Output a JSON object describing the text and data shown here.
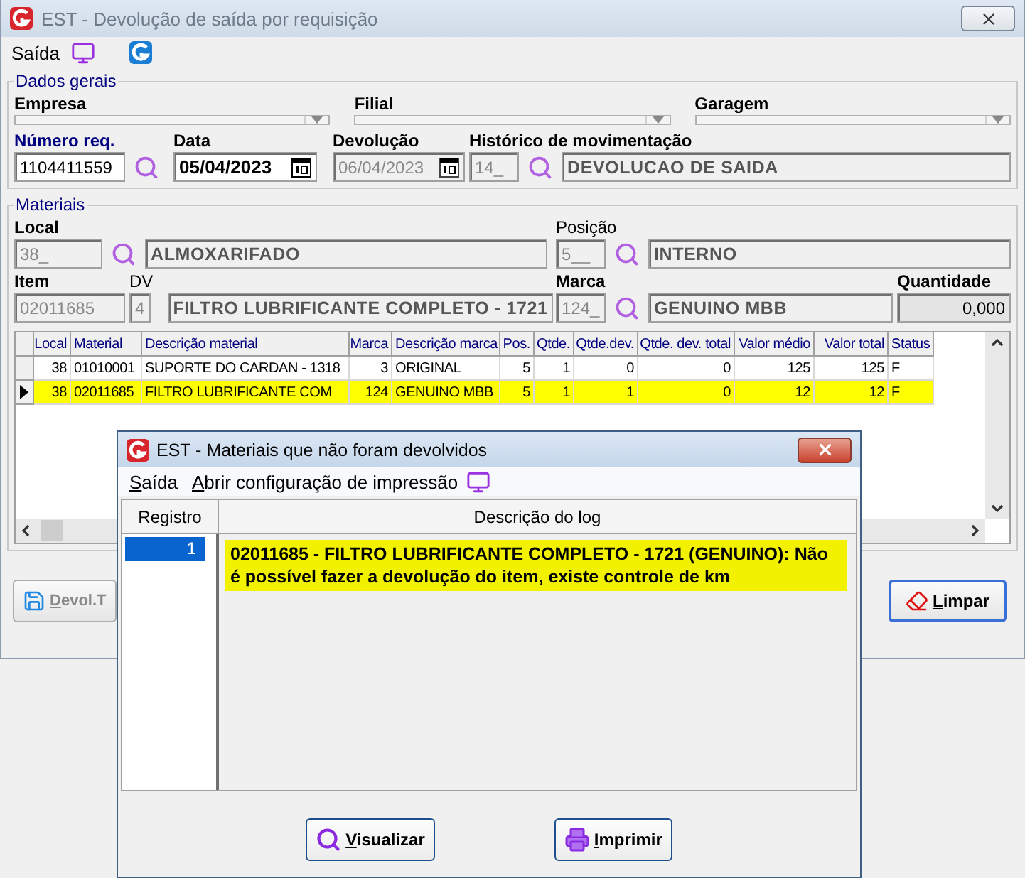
{
  "window": {
    "title": "EST -  Devolução de saída por requisição"
  },
  "toolbar": {
    "menu": "Saída"
  },
  "dados_gerais": {
    "title": "Dados gerais",
    "empresa": {
      "label": "Empresa"
    },
    "filial": {
      "label": "Filial"
    },
    "garagem": {
      "label": "Garagem"
    },
    "numero_req": {
      "label": "Número req.",
      "value": "1104411559"
    },
    "data": {
      "label": "Data",
      "value": "05/04/2023",
      "disabled": false
    },
    "devolucao": {
      "label": "Devolução",
      "value": "06/04/2023",
      "disabled": true
    },
    "historico": {
      "label": "Histórico de movimentação",
      "code": "14_",
      "description": "DEVOLUCAO DE SAIDA"
    }
  },
  "materiais": {
    "title": "Materiais",
    "local": {
      "label": "Local",
      "required": true,
      "code": "38_",
      "description": "ALMOXARIFADO"
    },
    "posicao": {
      "label": "Posição",
      "required": false,
      "code": "5__",
      "description": "INTERNO"
    },
    "item": {
      "label": "Item",
      "required": true,
      "code": "02011685"
    },
    "dv": {
      "label": "DV",
      "required": false,
      "value": "4",
      "description": "FILTRO LUBRIFICANTE COMPLETO - 1721"
    },
    "marca": {
      "label": "Marca",
      "required": true,
      "code": "124_",
      "description": "GENUINO MBB"
    },
    "quantidade": {
      "label": "Quantidade",
      "required": true,
      "value": "0,000"
    }
  },
  "table": {
    "columns": [
      {
        "label": "Local",
        "kind": "number"
      },
      {
        "label": "Material",
        "kind": "text"
      },
      {
        "label": "Descrição material",
        "kind": "text"
      },
      {
        "label": "Marca",
        "kind": "number"
      },
      {
        "label": "Descrição marca",
        "kind": "text"
      },
      {
        "label": "Pos.",
        "kind": "number"
      },
      {
        "label": "Qtde.",
        "kind": "number"
      },
      {
        "label": "Qtde.dev.",
        "kind": "number"
      },
      {
        "label": "Qtde. dev. total",
        "kind": "number"
      },
      {
        "label": "Valor médio",
        "kind": "number"
      },
      {
        "label": "Valor total",
        "kind": "number"
      },
      {
        "label": "Status",
        "kind": "text"
      }
    ],
    "rows": [
      {
        "selected": false,
        "cells": [
          "38",
          "01010001",
          "SUPORTE DO CARDAN - 1318",
          "3",
          "ORIGINAL",
          "5",
          "1",
          "0",
          "0",
          "125",
          "125",
          "F"
        ]
      },
      {
        "selected": true,
        "cells": [
          "38",
          "02011685",
          "FILTRO LUBRIFICANTE COM",
          "124",
          "GENUINO MBB",
          "5",
          "1",
          "1",
          "0",
          "12",
          "12",
          "F"
        ]
      }
    ]
  },
  "buttons": [
    {
      "label": "Devol.T",
      "kind": "save"
    },
    {
      "label": "Limpar",
      "kind": "clear"
    }
  ],
  "dialog": {
    "title": "EST - Materiais que não foram devolvidos",
    "menu": [
      {
        "label": "Saída"
      },
      {
        "label": "Abrir configuração de impressão"
      }
    ],
    "columns": [
      "Registro",
      "Descrição do log"
    ],
    "rows": [
      {
        "registro": "1",
        "descricao": "02011685 - FILTRO LUBRIFICANTE COMPLETO - 1721 (GENUINO): Não é possível fazer a devolução do item, existe controle de km",
        "selected": true
      }
    ],
    "buttons": [
      {
        "label": "Visualizar",
        "kind": "preview"
      },
      {
        "label": "Imprimir",
        "kind": "print"
      }
    ]
  }
}
